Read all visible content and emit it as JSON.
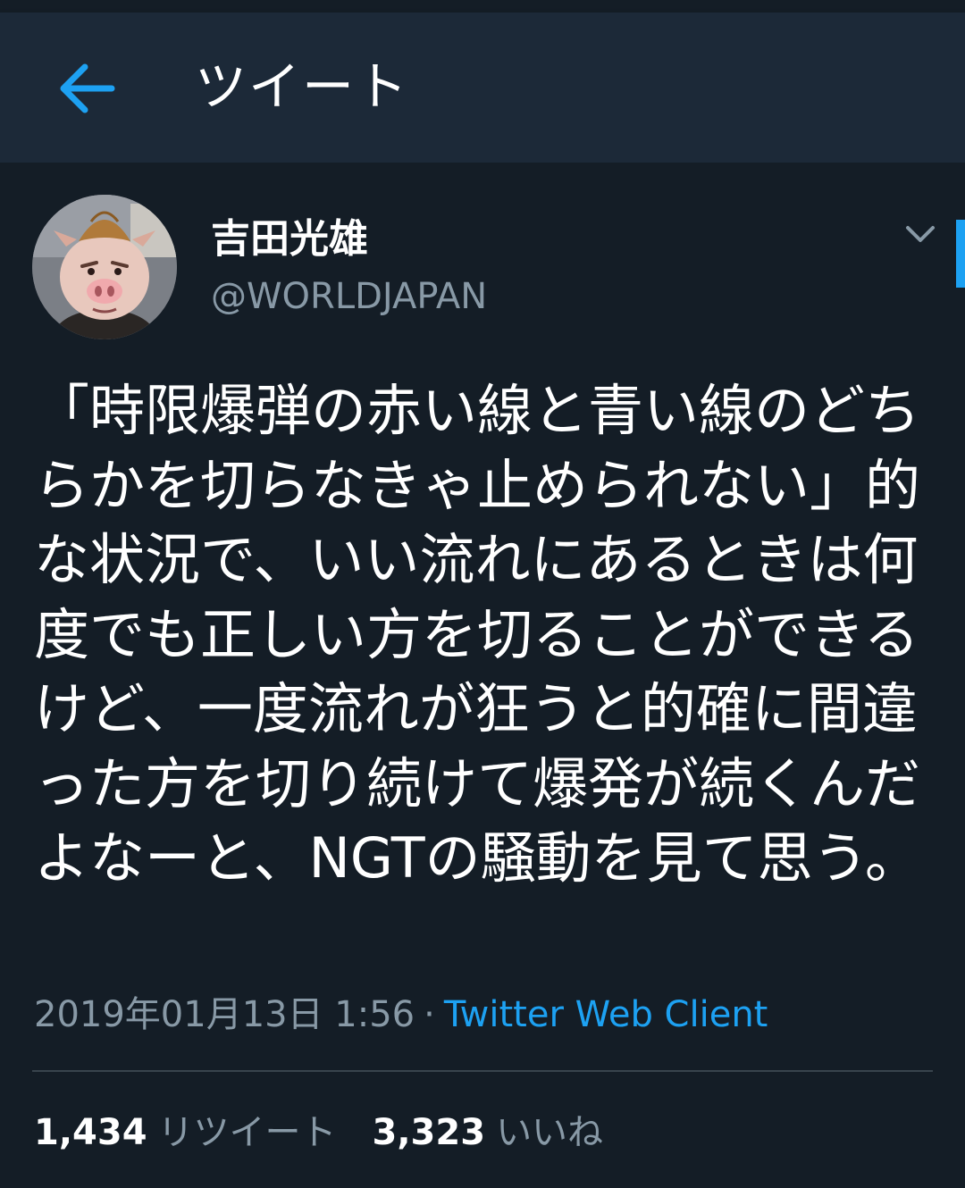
{
  "header": {
    "title": "ツイート",
    "back_icon": "arrow-left-icon",
    "accent_color": "#1da1f2"
  },
  "user": {
    "name": "吉田光雄",
    "handle": "@WORLDJAPAN",
    "avatar_icon": "pig-mask-avatar",
    "menu_icon": "chevron-down-icon"
  },
  "tweet": {
    "text": "「時限爆弾の赤い線と青い線のどちらかを切らなきゃ止められない」的な状況で、いい流れにあるときは何度でも正しい方を切ることができるけど、一度流れが狂うと的確に間違った方を切り続けて爆発が続くんだよなーと、NGTの騒動を見て思う。",
    "date": "2019年01月13日 1:56",
    "separator": "·",
    "source": "Twitter Web Client"
  },
  "stats": {
    "retweets_count": "1,434",
    "retweets_label": "リツイート",
    "likes_count": "3,323",
    "likes_label": "いいね"
  }
}
